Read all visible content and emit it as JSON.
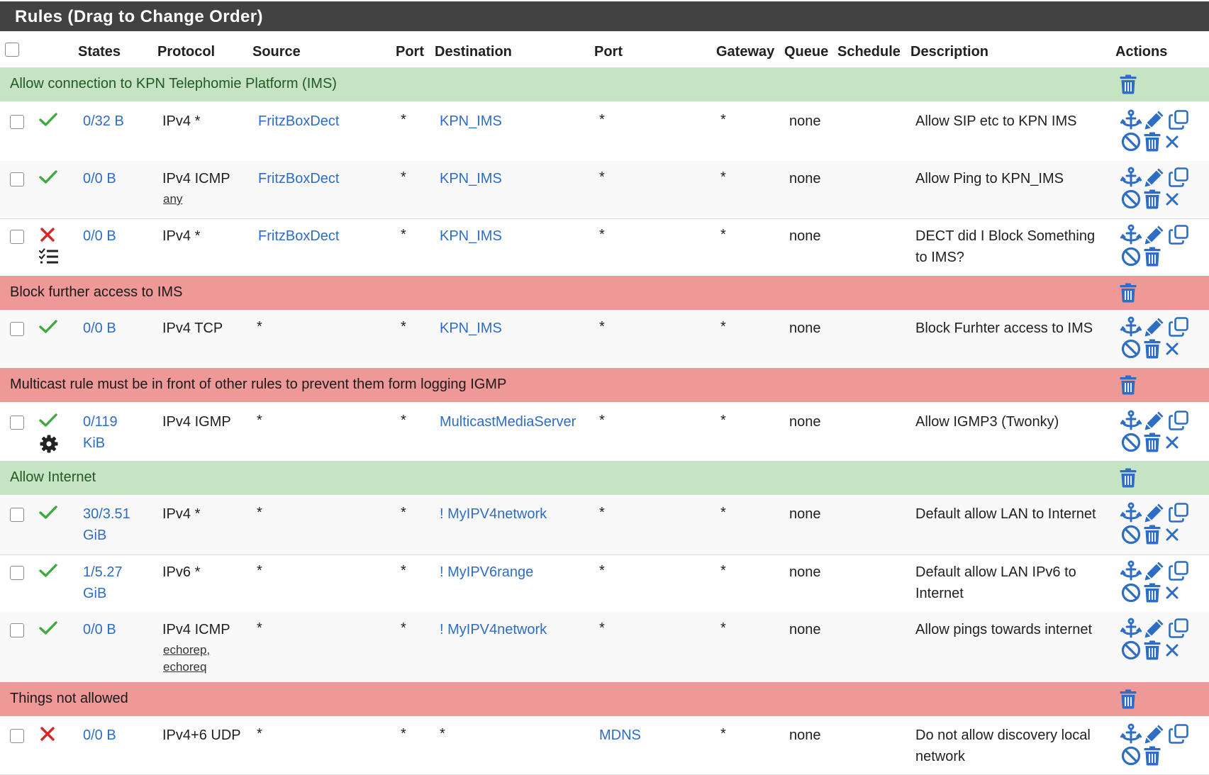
{
  "panel": {
    "title": "Rules (Drag to Change Order)"
  },
  "headers": {
    "states": "States",
    "protocol": "Protocol",
    "source": "Source",
    "port": "Port",
    "destination": "Destination",
    "port2": "Port",
    "gateway": "Gateway",
    "queue": "Queue",
    "schedule": "Schedule",
    "description": "Description",
    "actions": "Actions"
  },
  "colors": {
    "header_bg": "#424242",
    "link": "#2d6dc5",
    "pass": "#3caa3c",
    "block": "#d82626",
    "allow_separator": "#c6e4c4",
    "block_separator": "#ef9898"
  },
  "icons": {
    "row_actions": [
      "anchor-icon",
      "pencil-icon",
      "copy-icon",
      "disable-icon",
      "trash-icon",
      "close-icon"
    ],
    "separator_action": "trash-icon",
    "status": [
      "check-icon",
      "x-icon",
      "list-check-icon",
      "gear-icon"
    ]
  },
  "separators": [
    {
      "text": "Allow connection to KPN Telephomie Platform (IMS)",
      "color": "green"
    },
    {
      "text": "Block further access to IMS",
      "color": "red"
    },
    {
      "text": "Multicast rule must be in front of other rules to prevent them form logging IGMP",
      "color": "red"
    },
    {
      "text": "Allow Internet",
      "color": "green"
    },
    {
      "text": "Things not allowed",
      "color": "red"
    }
  ],
  "rules": [
    {
      "status": "pass",
      "extra_icon": "",
      "states": [
        "0/32 B"
      ],
      "protocol": "IPv4 *",
      "protocol_sub": [],
      "source": "FritzBoxDect",
      "port": "*",
      "destination": "KPN_IMS",
      "dest_port": "*",
      "gateway": "*",
      "queue": "none",
      "schedule": "",
      "description": [
        "Allow SIP etc to KPN IMS"
      ]
    },
    {
      "status": "pass",
      "extra_icon": "",
      "states": [
        "0/0 B"
      ],
      "protocol": "IPv4 ICMP",
      "protocol_sub": [
        "any"
      ],
      "source": "FritzBoxDect",
      "port": "*",
      "destination": "KPN_IMS",
      "dest_port": "*",
      "gateway": "*",
      "queue": "none",
      "schedule": "",
      "description": [
        "Allow Ping to KPN_IMS"
      ]
    },
    {
      "status": "block",
      "extra_icon": "list-check-icon",
      "states": [
        "0/0 B"
      ],
      "protocol": "IPv4 *",
      "protocol_sub": [],
      "source": "FritzBoxDect",
      "port": "*",
      "destination": "KPN_IMS",
      "dest_port": "*",
      "gateway": "*",
      "queue": "none",
      "schedule": "",
      "description": [
        "DECT did I Block Something",
        "to IMS?"
      ]
    },
    {
      "status": "pass",
      "extra_icon": "",
      "states": [
        "0/0 B"
      ],
      "protocol": "IPv4 TCP",
      "protocol_sub": [],
      "source": "*",
      "port": "*",
      "destination": "KPN_IMS",
      "dest_port": "*",
      "gateway": "*",
      "queue": "none",
      "schedule": "",
      "description": [
        "Block Furhter access to IMS"
      ]
    },
    {
      "status": "pass",
      "extra_icon": "gear-icon",
      "states": [
        "0/119",
        "KiB"
      ],
      "protocol": "IPv4 IGMP",
      "protocol_sub": [],
      "source": "*",
      "port": "*",
      "destination": "MulticastMediaServer",
      "dest_port": "*",
      "gateway": "*",
      "queue": "none",
      "schedule": "",
      "description": [
        "Allow IGMP3 (Twonky)"
      ]
    },
    {
      "status": "pass",
      "extra_icon": "",
      "states": [
        "30/3.51",
        "GiB"
      ],
      "protocol": "IPv4 *",
      "protocol_sub": [],
      "source": "*",
      "port": "*",
      "destination": "! MyIPV4network",
      "dest_port": "*",
      "gateway": "*",
      "queue": "none",
      "schedule": "",
      "description": [
        "Default allow LAN to Internet"
      ]
    },
    {
      "status": "pass",
      "extra_icon": "",
      "states": [
        "1/5.27",
        "GiB"
      ],
      "protocol": "IPv6 *",
      "protocol_sub": [],
      "source": "*",
      "port": "*",
      "destination": "! MyIPV6range",
      "dest_port": "*",
      "gateway": "*",
      "queue": "none",
      "schedule": "",
      "description": [
        "Default allow LAN IPv6 to",
        "Internet"
      ]
    },
    {
      "status": "pass",
      "extra_icon": "",
      "states": [
        "0/0 B"
      ],
      "protocol": "IPv4 ICMP",
      "protocol_sub": [
        "echorep,",
        "echoreq"
      ],
      "source": "*",
      "port": "*",
      "destination": "! MyIPV4network",
      "dest_port": "*",
      "gateway": "*",
      "queue": "none",
      "schedule": "",
      "description": [
        "Allow pings towards internet"
      ]
    },
    {
      "status": "block",
      "extra_icon": "",
      "states": [
        "0/0 B"
      ],
      "protocol": "IPv4+6 UDP",
      "protocol_sub": [],
      "source": "*",
      "port": "*",
      "destination": "*",
      "dest_port": "MDNS",
      "gateway": "*",
      "queue": "none",
      "schedule": "",
      "description": [
        "Do not allow discovery local",
        "network"
      ]
    }
  ]
}
